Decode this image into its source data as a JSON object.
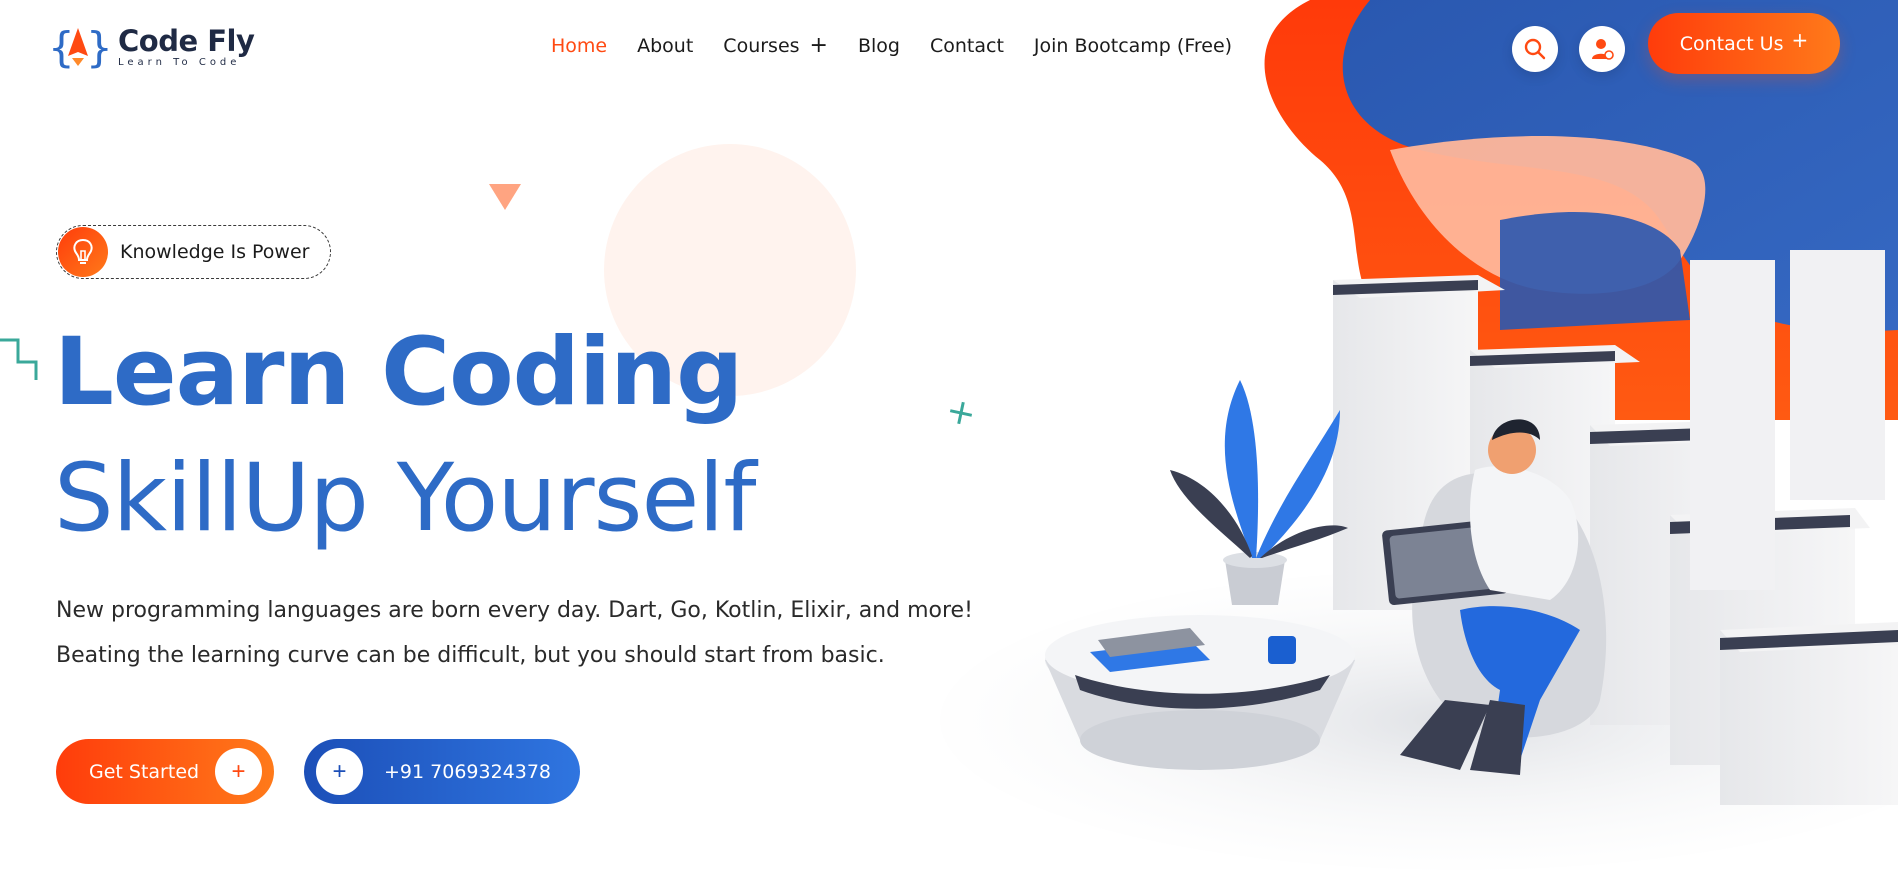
{
  "brand": {
    "name": "Code Fly",
    "tagline": "Learn To Code",
    "colors": {
      "primary_orange": "#ff4a12",
      "primary_blue": "#2e6bc6",
      "dark": "#1f2a44"
    }
  },
  "nav": {
    "items": [
      {
        "label": "Home",
        "active": true,
        "has_submenu": false
      },
      {
        "label": "About",
        "active": false,
        "has_submenu": false
      },
      {
        "label": "Courses",
        "active": false,
        "has_submenu": true,
        "submenu_icon": "+"
      },
      {
        "label": "Blog",
        "active": false,
        "has_submenu": false
      },
      {
        "label": "Contact",
        "active": false,
        "has_submenu": false
      },
      {
        "label": "Join Bootcamp (Free)",
        "active": false,
        "has_submenu": false
      }
    ]
  },
  "header_actions": {
    "search_icon": "search-icon",
    "user_icon": "user-icon",
    "contact_label": "Contact Us",
    "contact_icon": "+"
  },
  "hero": {
    "badge_text": "Knowledge Is Power",
    "badge_icon": "lightbulb-icon",
    "title": "Learn Coding",
    "subtitle": "SkillUp Yourself",
    "description": "New programming languages are born every day. Dart, Go, Kotlin, Elixir, and more! Beating the learning curve can be difficult, but you should start from basic.",
    "primary_button": {
      "label": "Get Started",
      "icon": "+"
    },
    "phone_button": {
      "label": "+91 7069324378",
      "icon": "+"
    }
  }
}
